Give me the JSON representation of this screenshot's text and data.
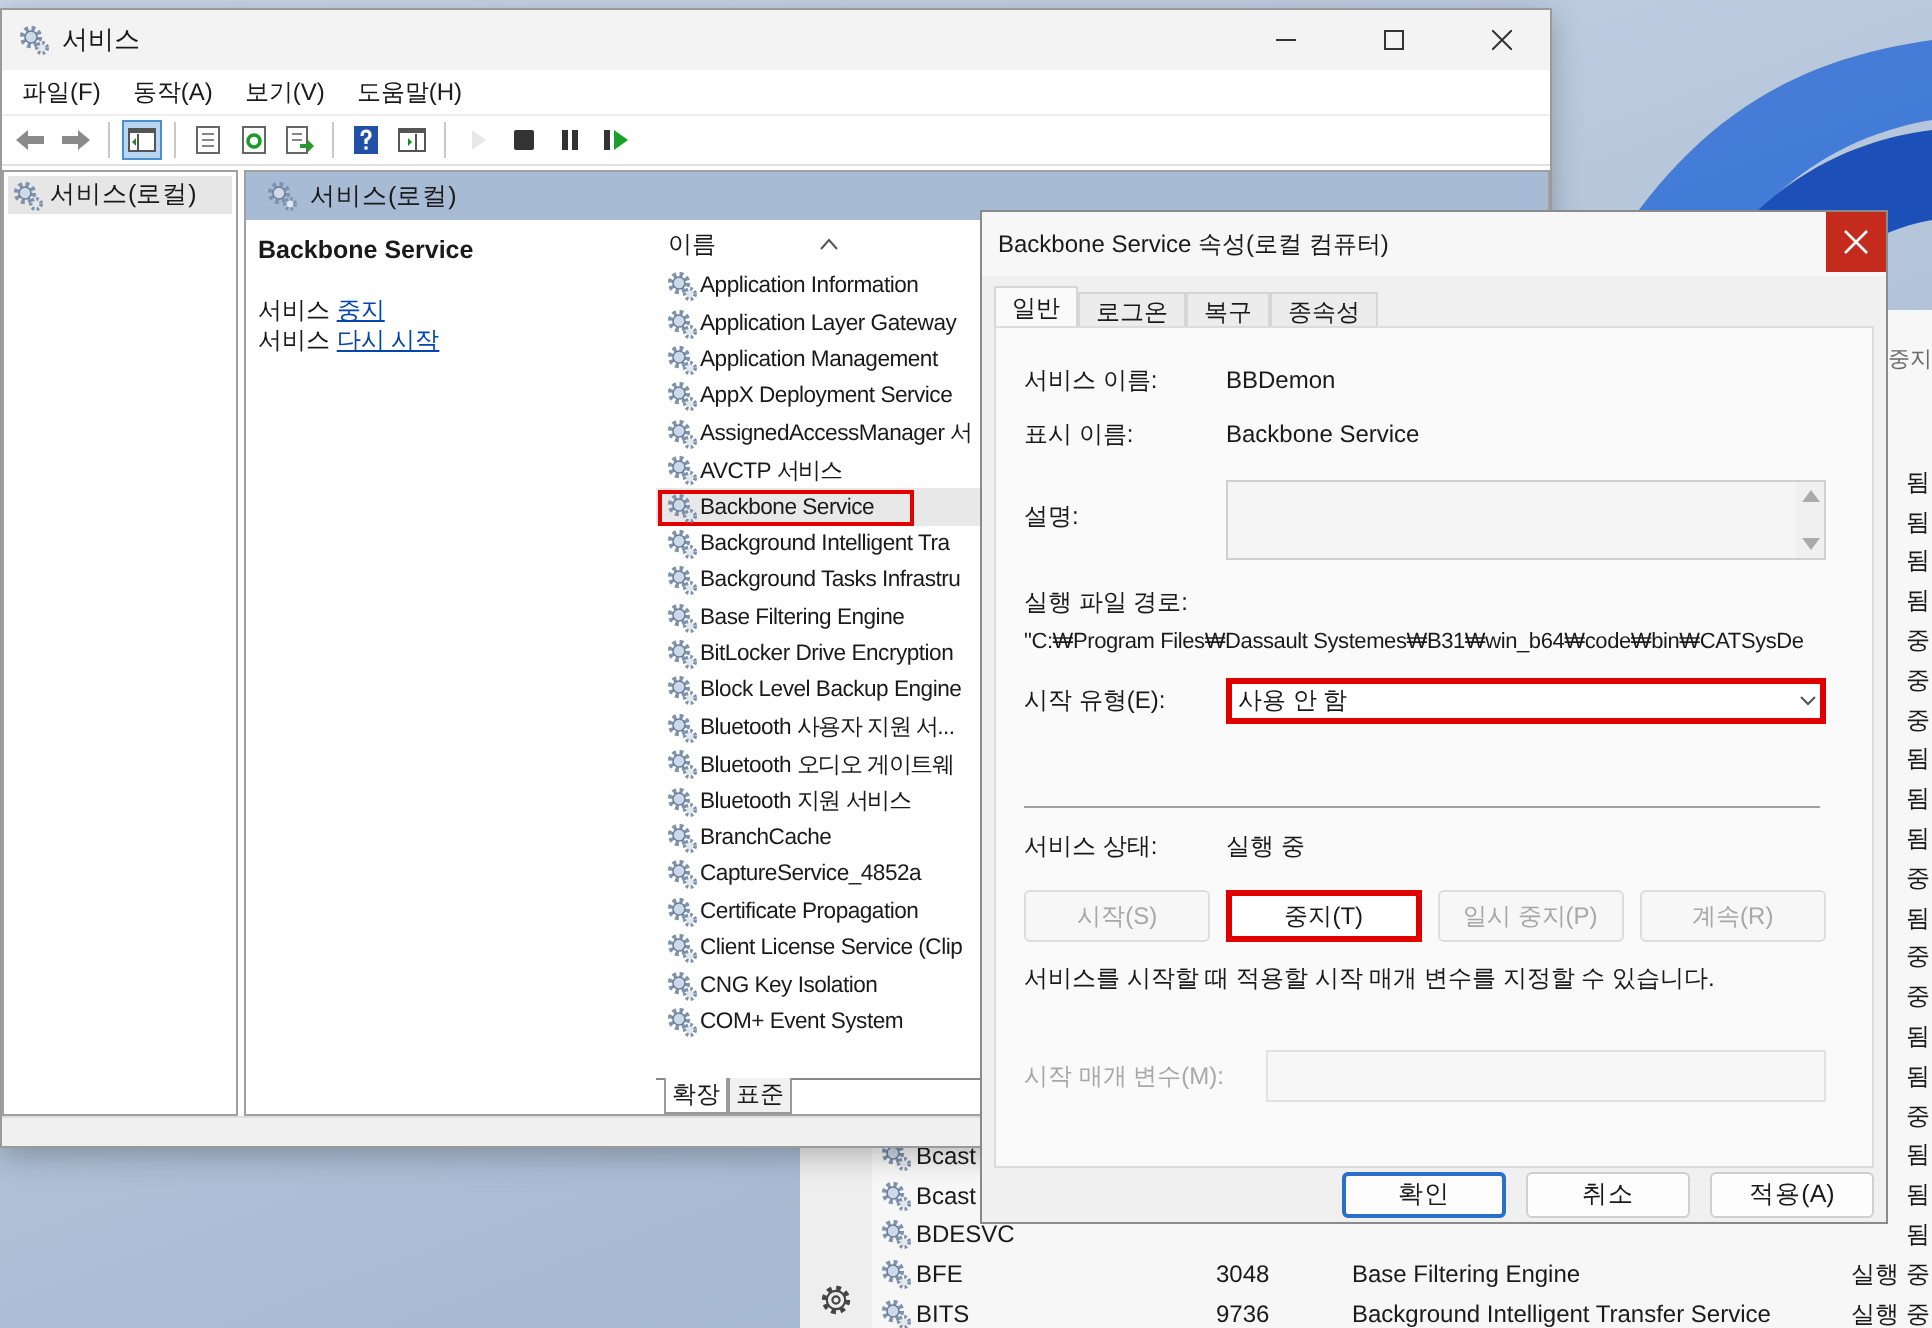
{
  "background_window": {
    "toolbar_text": "중지",
    "rows": [
      {
        "status": "됨"
      },
      {
        "status": "됨"
      },
      {
        "status": "됨"
      },
      {
        "status": "됨"
      },
      {
        "status": "중"
      },
      {
        "status": "중"
      },
      {
        "status": "중"
      },
      {
        "status": "됨"
      },
      {
        "status": "됨"
      },
      {
        "status": "됨"
      },
      {
        "status": "중"
      },
      {
        "status": "됨"
      },
      {
        "status": "중"
      },
      {
        "status": "중"
      },
      {
        "status": "됨"
      },
      {
        "status": "됨"
      },
      {
        "status": "중"
      },
      {
        "name": "Bcast",
        "status": "됨"
      },
      {
        "name": "Bcast",
        "status": "됨"
      },
      {
        "name": "BDESVC",
        "status": "됨"
      },
      {
        "name": "BFE",
        "pid": "3048",
        "description": "Base Filtering Engine",
        "status": "실행 중"
      },
      {
        "name": "BITS",
        "pid": "9736",
        "description": "Background Intelligent Transfer Service",
        "status": "실행 중"
      }
    ]
  },
  "services_window": {
    "title": "서비스",
    "menu": [
      "파일(F)",
      "동작(A)",
      "보기(V)",
      "도움말(H)"
    ],
    "toolbar": [
      {
        "kind": "back",
        "pressed": false,
        "disabled": false
      },
      {
        "kind": "forward",
        "pressed": false,
        "disabled": false
      },
      {
        "kind": "separator"
      },
      {
        "kind": "tree",
        "pressed": true,
        "disabled": false
      },
      {
        "kind": "separator"
      },
      {
        "kind": "properties",
        "pressed": false,
        "disabled": false
      },
      {
        "kind": "refresh",
        "pressed": false,
        "disabled": false
      },
      {
        "kind": "export",
        "pressed": false,
        "disabled": false
      },
      {
        "kind": "separator"
      },
      {
        "kind": "help",
        "pressed": false,
        "disabled": false
      },
      {
        "kind": "pane",
        "pressed": false,
        "disabled": false
      },
      {
        "kind": "separator"
      },
      {
        "kind": "play",
        "pressed": false,
        "disabled": true
      },
      {
        "kind": "stop",
        "pressed": false,
        "disabled": false
      },
      {
        "kind": "pause",
        "pressed": false,
        "disabled": false
      },
      {
        "kind": "resume",
        "pressed": false,
        "disabled": false
      }
    ],
    "tree": [
      {
        "label": "서비스(로컬)",
        "selected": true
      }
    ],
    "pane_header": "서비스(로컬)",
    "detail": {
      "title": "Backbone Service",
      "actions": [
        {
          "prefix": "서비스",
          "link": "중지"
        },
        {
          "prefix": "서비스",
          "link": "다시 시작"
        }
      ]
    },
    "column_header": "이름",
    "services": [
      {
        "name": "Application Information",
        "selected": false,
        "highlighted": false
      },
      {
        "name": "Application Layer Gateway",
        "selected": false,
        "highlighted": false
      },
      {
        "name": "Application Management",
        "selected": false,
        "highlighted": false
      },
      {
        "name": "AppX Deployment Service",
        "selected": false,
        "highlighted": false
      },
      {
        "name": "AssignedAccessManager 서",
        "selected": false,
        "highlighted": false
      },
      {
        "name": "AVCTP 서비스",
        "selected": false,
        "highlighted": false
      },
      {
        "name": "Backbone Service",
        "selected": true,
        "highlighted": true
      },
      {
        "name": "Background Intelligent Tra",
        "selected": false,
        "highlighted": false
      },
      {
        "name": "Background Tasks Infrastru",
        "selected": false,
        "highlighted": false
      },
      {
        "name": "Base Filtering Engine",
        "selected": false,
        "highlighted": false
      },
      {
        "name": "BitLocker Drive Encryption",
        "selected": false,
        "highlighted": false
      },
      {
        "name": "Block Level Backup Engine",
        "selected": false,
        "highlighted": false
      },
      {
        "name": "Bluetooth 사용자 지원 서...",
        "selected": false,
        "highlighted": false
      },
      {
        "name": "Bluetooth 오디오 게이트웨",
        "selected": false,
        "highlighted": false
      },
      {
        "name": "Bluetooth 지원 서비스",
        "selected": false,
        "highlighted": false
      },
      {
        "name": "BranchCache",
        "selected": false,
        "highlighted": false
      },
      {
        "name": "CaptureService_4852a",
        "selected": false,
        "highlighted": false
      },
      {
        "name": "Certificate Propagation",
        "selected": false,
        "highlighted": false
      },
      {
        "name": "Client License Service (Clip",
        "selected": false,
        "highlighted": false
      },
      {
        "name": "CNG Key Isolation",
        "selected": false,
        "highlighted": false
      },
      {
        "name": "COM+ Event System",
        "selected": false,
        "highlighted": false
      }
    ],
    "view_tabs": [
      {
        "label": "확장",
        "selected": true
      },
      {
        "label": "표준",
        "selected": false
      }
    ]
  },
  "dialog": {
    "title": "Backbone Service 속성(로컬 컴퓨터)",
    "tabs": [
      {
        "label": "일반",
        "selected": true
      },
      {
        "label": "로그온",
        "selected": false
      },
      {
        "label": "복구",
        "selected": false
      },
      {
        "label": "종속성",
        "selected": false
      }
    ],
    "service_name": {
      "label": "서비스 이름:",
      "value": "BBDemon"
    },
    "display_name": {
      "label": "표시 이름:",
      "value": "Backbone Service"
    },
    "description": {
      "label": "설명:"
    },
    "executable_path": {
      "label": "실행 파일 경로:",
      "value": "\"C:₩Program Files₩Dassault Systemes₩B31₩win_b64₩code₩bin₩CATSysDe"
    },
    "startup_type": {
      "label": "시작 유형(E):",
      "value": "사용 안 함",
      "highlighted": true
    },
    "service_status": {
      "label": "서비스 상태:",
      "value": "실행 중"
    },
    "control_buttons": [
      {
        "label": "시작(S)",
        "disabled": true,
        "highlighted": false
      },
      {
        "label": "중지(T)",
        "disabled": false,
        "highlighted": true
      },
      {
        "label": "일시 중지(P)",
        "disabled": true,
        "highlighted": false
      },
      {
        "label": "계속(R)",
        "disabled": true,
        "highlighted": false
      }
    ],
    "note": "서비스를 시작할 때 적용할 시작 매개 변수를 지정할 수 있습니다.",
    "start_parameters": {
      "label": "시작 매개 변수(M):",
      "disabled": true
    },
    "buttons": [
      {
        "label": "확인",
        "default": true
      },
      {
        "label": "취소",
        "default": false
      },
      {
        "label": "적용(A)",
        "default": false
      }
    ]
  }
}
